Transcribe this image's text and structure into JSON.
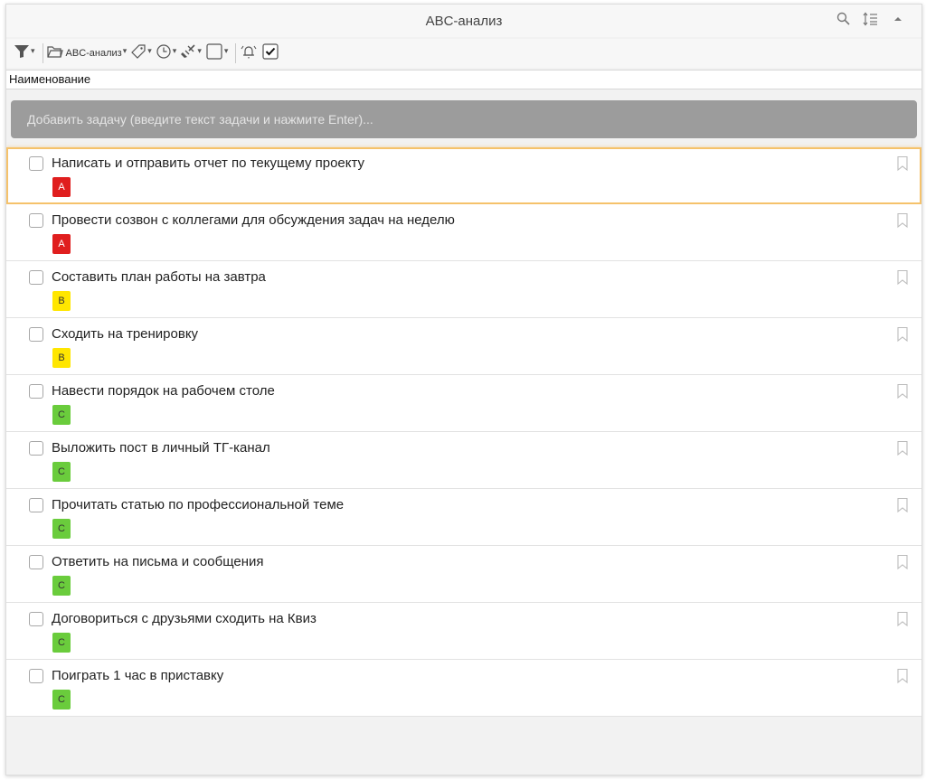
{
  "window": {
    "title": "ABC-анализ"
  },
  "toolbar": {
    "folder_label": "ABC-анализ"
  },
  "columns": {
    "name_header": "Наименование"
  },
  "add_task": {
    "placeholder": "Добавить задачу (введите текст задачи и нажмите Enter)..."
  },
  "colors": {
    "A": "#e01e1e",
    "B": "#ffe600",
    "C": "#6acc3c",
    "selection": "#f5c26b",
    "add_bar": "#9c9c9c"
  },
  "tasks": [
    {
      "text": "Написать и отправить отчет по текущему проекту",
      "priority": "A",
      "selected": true
    },
    {
      "text": "Провести созвон с коллегами для обсуждения задач на неделю",
      "priority": "A",
      "selected": false
    },
    {
      "text": "Составить план работы на завтра",
      "priority": "B",
      "selected": false
    },
    {
      "text": "Сходить на тренировку",
      "priority": "B",
      "selected": false
    },
    {
      "text": "Навести порядок на рабочем столе",
      "priority": "C",
      "selected": false
    },
    {
      "text": "Выложить пост в личный ТГ-канал",
      "priority": "C",
      "selected": false
    },
    {
      "text": "Прочитать статью по профессиональной теме",
      "priority": "C",
      "selected": false
    },
    {
      "text": "Ответить на письма и сообщения",
      "priority": "C",
      "selected": false
    },
    {
      "text": "Договориться с друзьями сходить на Квиз",
      "priority": "C",
      "selected": false
    },
    {
      "text": "Поиграть 1 час в приставку",
      "priority": "C",
      "selected": false
    }
  ]
}
